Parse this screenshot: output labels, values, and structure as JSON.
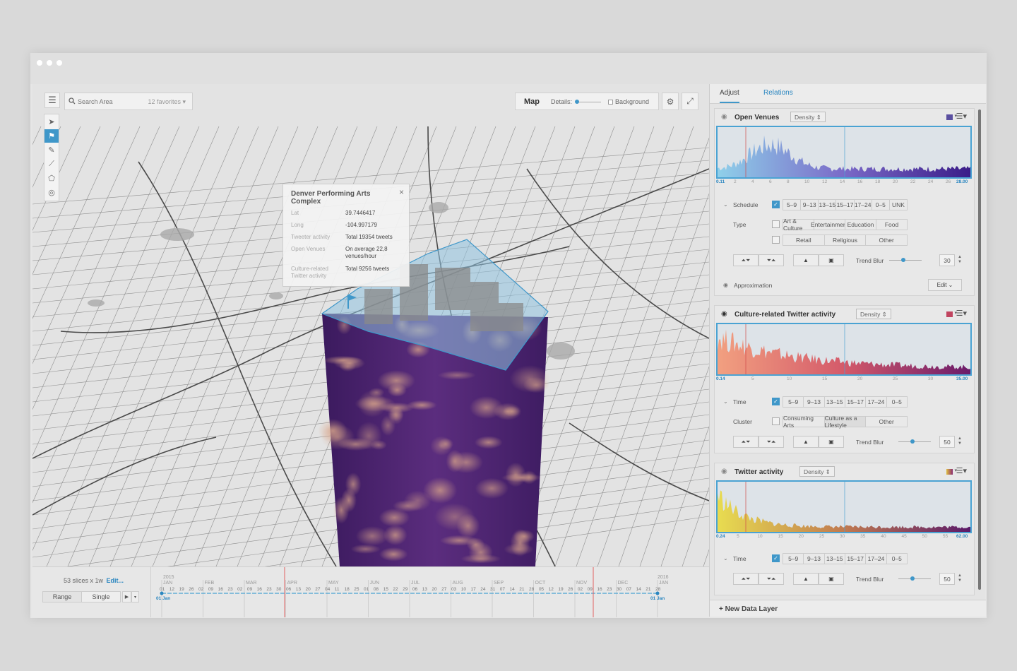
{
  "window": {
    "dots": [
      "",
      "",
      ""
    ]
  },
  "toolbar": {
    "search_placeholder": "Search Area",
    "favorites": "12 favorites",
    "map_label": "Map",
    "details_label": "Details:",
    "background_label": "Background"
  },
  "tools": [
    "pointer-icon",
    "flag-icon",
    "brush-icon",
    "line-icon",
    "polygon-icon",
    "circle-icon"
  ],
  "popup": {
    "title": "Denver Performing Arts Complex",
    "rows": [
      {
        "key": "Lat",
        "value": "39.7446417"
      },
      {
        "key": "Long",
        "value": "-104.997179"
      },
      {
        "key": "Tweeter activity",
        "value": "Total 19354 tweets"
      },
      {
        "key": "Open Venues",
        "value": "On average 22,8 venues/hour"
      },
      {
        "key": "Culture-related Twitter activity",
        "value": "Total 9256 tweets"
      }
    ]
  },
  "timeline": {
    "slices_text": "53 slices x 1w",
    "edit_link": "Edit...",
    "range_label": "Range",
    "single_label": "Single",
    "year_start": "2015",
    "year_end": "2016",
    "months": [
      "JAN",
      "FEB",
      "MAR",
      "APR",
      "MAY",
      "JUN",
      "JUL",
      "AUG",
      "SEP",
      "OCT",
      "NOV",
      "DEC",
      "JAN"
    ],
    "days": [
      "01",
      "12",
      "19",
      "26",
      "02",
      "09",
      "16",
      "23",
      "02",
      "09",
      "16",
      "23",
      "30",
      "06",
      "13",
      "20",
      "27",
      "04",
      "11",
      "18",
      "25",
      "01",
      "08",
      "15",
      "22",
      "29",
      "06",
      "13",
      "20",
      "27",
      "03",
      "10",
      "17",
      "24",
      "31",
      "07",
      "14",
      "21",
      "28",
      "05",
      "12",
      "19",
      "26",
      "02",
      "09",
      "16",
      "23",
      "30",
      "07",
      "14",
      "21",
      "28"
    ],
    "start_label": "01 Jan",
    "end_label": "01 Jan"
  },
  "panel": {
    "tab_adjust": "Adjust",
    "tab_relations": "Relations",
    "new_layer": "+ New Data Layer",
    "layers": [
      {
        "title": "Open Venues",
        "mode": "Density",
        "swatch": "#5a4fa0",
        "ticks": [
          "0.11",
          "2",
          "4",
          "6",
          "8",
          "10",
          "12",
          "14",
          "16",
          "18",
          "20",
          "22",
          "24",
          "26",
          "28.00"
        ],
        "filter1_label": "Schedule",
        "filter1_chips": [
          "5–9",
          "9–13",
          "13–15",
          "15–17",
          "17–24",
          "0–5",
          "UNK"
        ],
        "filter2_label": "Type",
        "filter2_chips": [
          "Art & Culture",
          "Entertainment",
          "Education",
          "Food"
        ],
        "filter2_chips_row2": [
          "Retail",
          "Religious",
          "Other"
        ],
        "trend_blur_label": "Trend Blur",
        "trend_blur_value": "30",
        "approx_label": "Approximation",
        "edit_label": "Edit"
      },
      {
        "title": "Culture-related Twitter activity",
        "mode": "Density",
        "swatch": "#c0445f",
        "ticks": [
          "0.14",
          "5",
          "10",
          "15",
          "20",
          "25",
          "30",
          "35.00"
        ],
        "filter1_label": "Time",
        "filter1_chips": [
          "5–9",
          "9–13",
          "13–15",
          "15–17",
          "17–24",
          "0–5"
        ],
        "filter2_label": "Cluster",
        "filter2_chips": [
          "Consuming Arts",
          "Culture as a Lifestyle",
          "Other"
        ],
        "trend_blur_label": "Trend Blur",
        "trend_blur_value": "50"
      },
      {
        "title": "Twitter activity",
        "mode": "Density",
        "swatch": "#b07030",
        "ticks": [
          "0.24",
          "5",
          "10",
          "15",
          "20",
          "25",
          "30",
          "35",
          "40",
          "45",
          "50",
          "55",
          "62.00"
        ],
        "filter1_label": "Time",
        "filter1_chips": [
          "5–9",
          "9–13",
          "13–15",
          "15–17",
          "17–24",
          "0–5"
        ],
        "trend_blur_label": "Trend Blur",
        "trend_blur_value": "50"
      }
    ]
  },
  "colors": {
    "accent": "#3f97c9",
    "link": "#2a86c0"
  }
}
